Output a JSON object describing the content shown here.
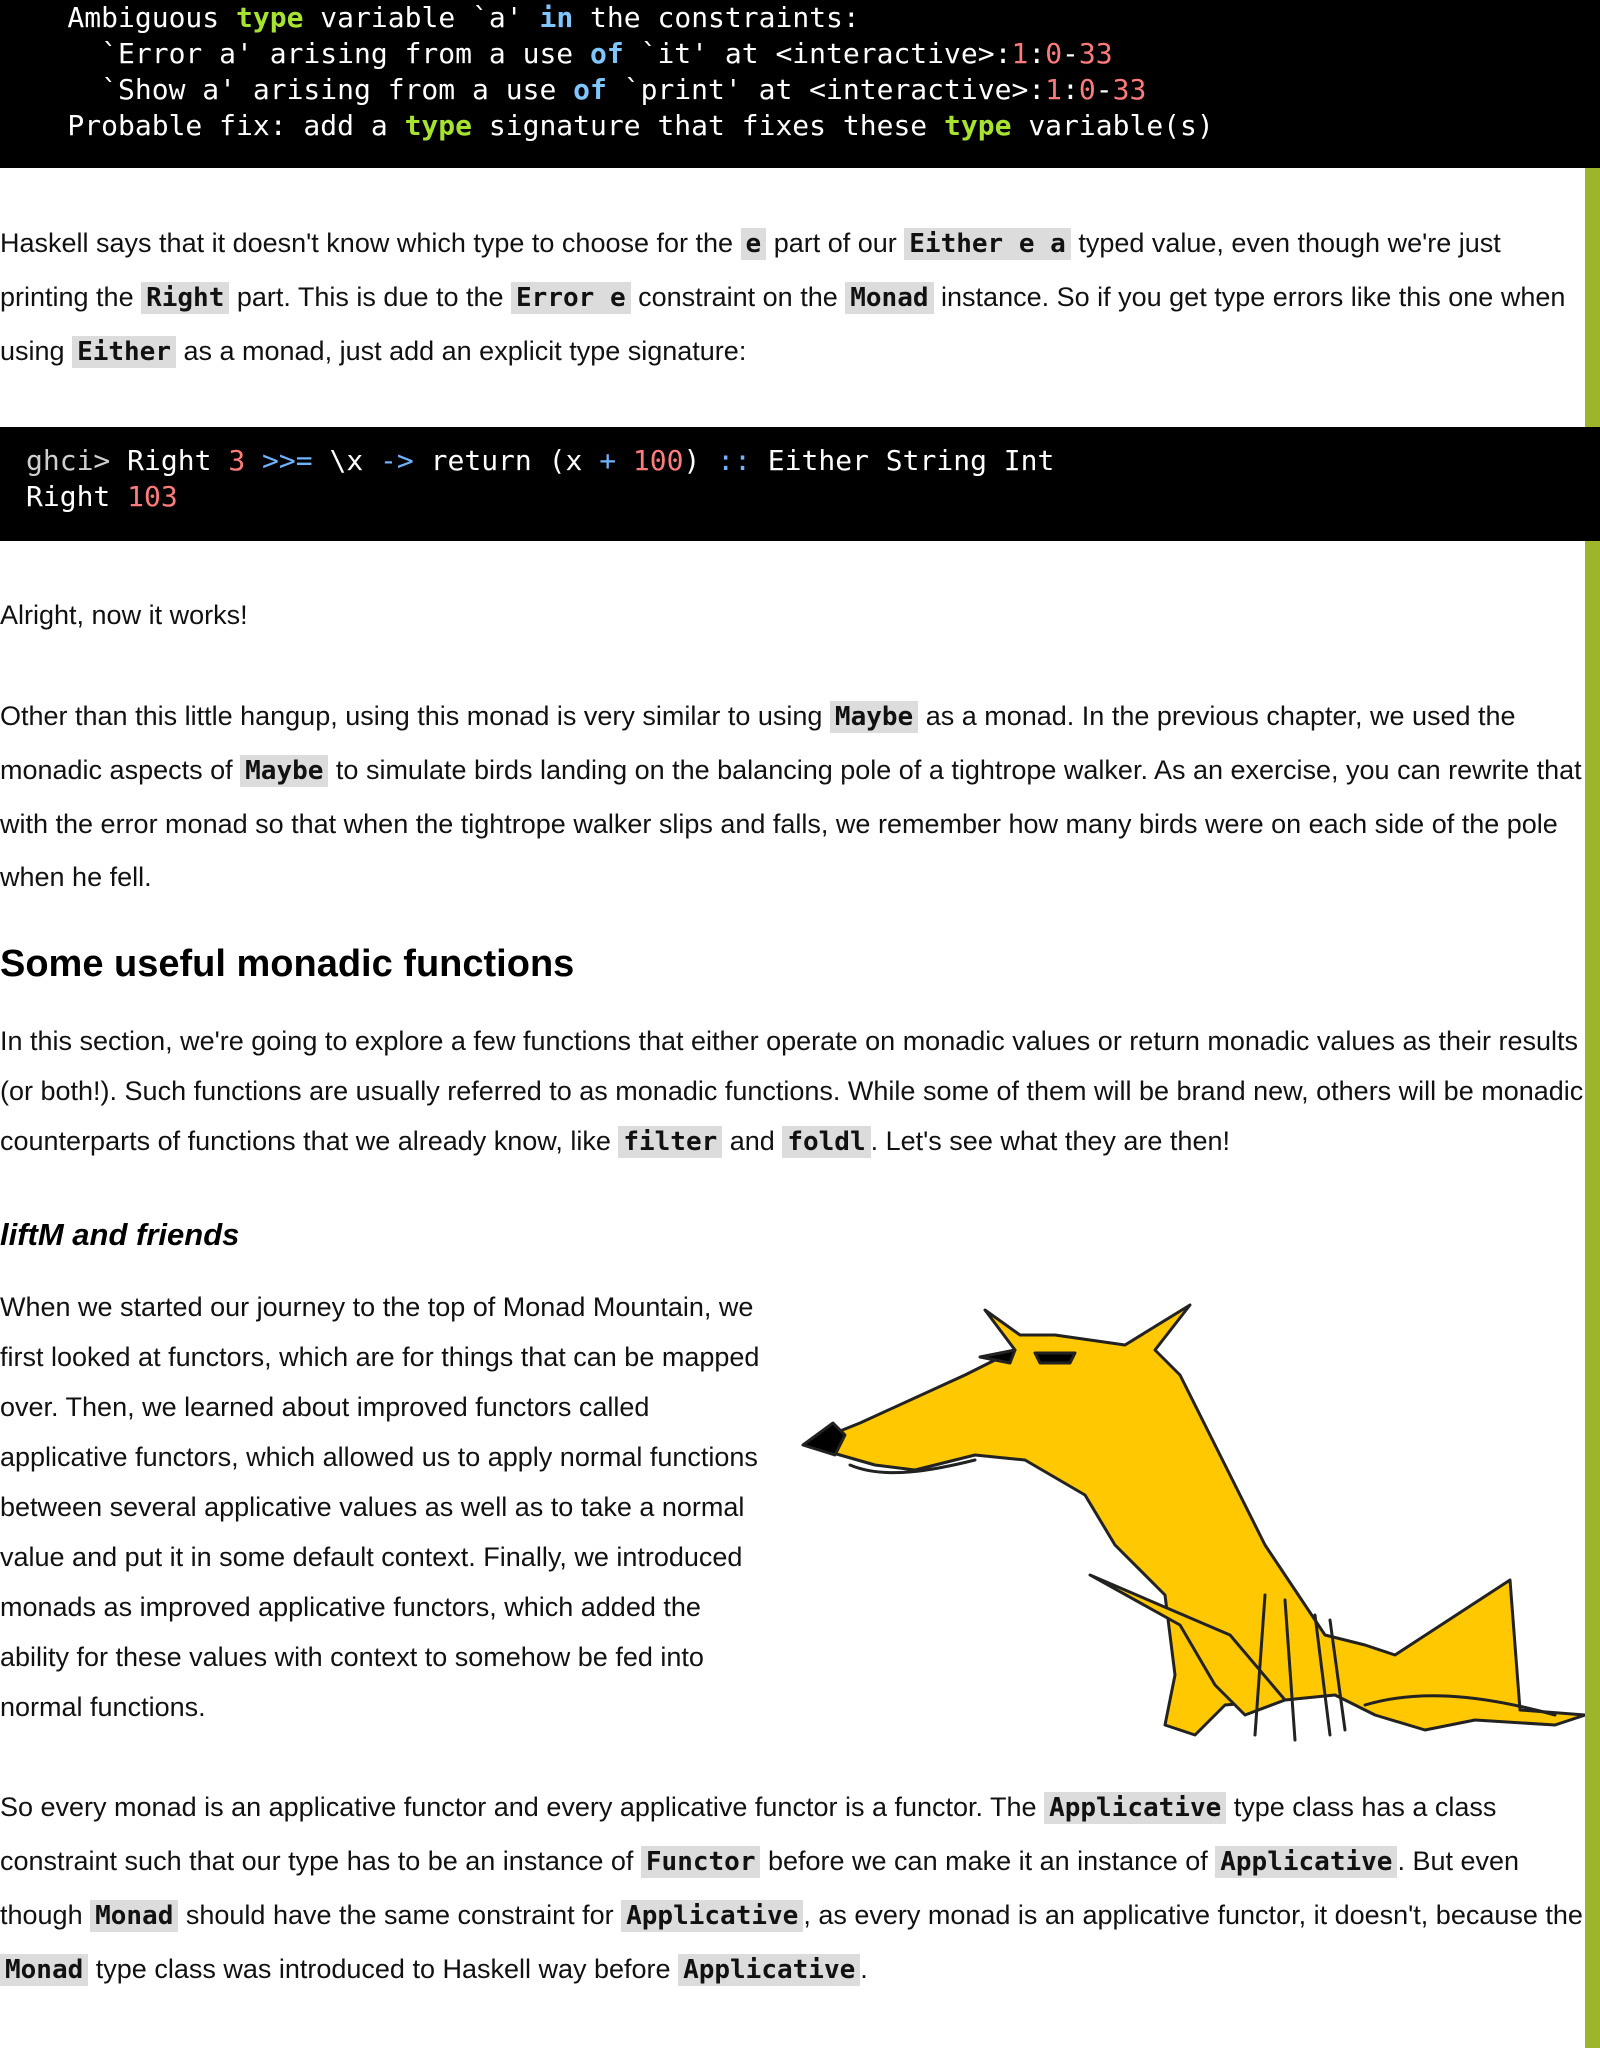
{
  "code_block_1": {
    "line1_a": "    Ambiguous ",
    "line1_type": "type",
    "line1_b": " variable `a' ",
    "line1_in": "in",
    "line1_c": " the constraints:",
    "line2_a": "      `Error a' arising from a use ",
    "line2_of": "of",
    "line2_b": " `it' at <interactive>:",
    "line2_n1": "1",
    "line2_c": ":",
    "line2_n2": "0",
    "line2_d": "-",
    "line2_n3": "33",
    "line3_a": "      `Show a' arising from a use ",
    "line3_of": "of",
    "line3_b": " `print' at <interactive>:",
    "line3_n1": "1",
    "line3_c": ":",
    "line3_n2": "0",
    "line3_d": "-",
    "line3_n3": "33",
    "line4_a": "    Probable fix: add a ",
    "line4_type1": "type",
    "line4_b": " signature that fixes these ",
    "line4_type2": "type",
    "line4_c": " variable(s)"
  },
  "para1": {
    "t1": "Haskell says that it doesn't know which type to choose for the ",
    "c1": "e",
    "t2": " part of our ",
    "c2": "Either e a",
    "t3": " typed value, even though we're just printing the ",
    "c3": "Right",
    "t4": " part. This is due to the ",
    "c4": "Error e",
    "t5": " constraint on the ",
    "c5": "Monad",
    "t6": " instance. So if you get type errors like this one when using ",
    "c6": "Either",
    "t7": " as a monad, just add an explicit type signature:"
  },
  "code_block_2": {
    "prompt": "ghci>",
    "a": " Right ",
    "n1": "3",
    "sp1": " ",
    "bind": ">>=",
    "b": " \\x ",
    "arrow": "->",
    "c": " return (x ",
    "plus": "+",
    "sp2": " ",
    "n2": "100",
    "d": ") ",
    "dcolon": "::",
    "e": " Either String Int",
    "line2_a": "Right ",
    "line2_n": "103"
  },
  "para2": "Alright, now it works!",
  "para3": {
    "t1": "Other than this little hangup, using this monad is very similar to using ",
    "c1": "Maybe",
    "t2": " as a monad. In the previous chapter, we used the monadic aspects of ",
    "c2": "Maybe",
    "t3": " to simulate birds landing on the balancing pole of a tightrope walker. As an exercise, you can rewrite that with the error monad so that when the tightrope walker slips and falls, we remember how many birds were on each side of the pole when he fell."
  },
  "heading_section": "Some useful monadic functions",
  "para4": {
    "t1": "In this section, we're going to explore a few functions that either operate on monadic values or return monadic values as their results (or both!). Such functions are usually referred to as monadic functions. While some of them will be brand new, others will be monadic counterparts of functions that we already know, like ",
    "c1": "filter",
    "t2": " and ",
    "c2": "foldl",
    "t3": ". Let's see what they are then!"
  },
  "heading_sub": "liftM and friends",
  "para5": "When we started our journey to the top of Monad Mountain, we first looked at functors, which are for things that can be mapped over. Then, we learned about improved functors called applicative functors, which allowed us to apply normal functions between several applicative values as well as to take a normal value and put it in some default context. Finally, we introduced monads as improved applicative functors, which added the ability for these values with context to somehow be fed into normal functions.",
  "para6": {
    "t1": "So every monad is an applicative functor and every applicative functor is a functor. The ",
    "c1": "Applicative",
    "t2": " type class has a class constraint such that our type has to be an instance of ",
    "c2": "Functor",
    "t3": " before we can make it an instance of ",
    "c3": "Applicative",
    "t4": ". But even though ",
    "c4": "Monad",
    "t5": " should have the same constraint for ",
    "c5": "Applicative",
    "t6": ", as every monad is an applicative functor, it doesn't, because the ",
    "c6": "Monad",
    "t7": " type class was introduced to Haskell way before ",
    "c7": "Applicative",
    "t8": "."
  },
  "colors": {
    "accent_bar": "#9db52a",
    "code_bg": "#000000",
    "keyword_green": "#a6e22e",
    "keyword_blue": "#7fc6ff",
    "number": "#ff7a7a",
    "wolf_fill": "#ffc800"
  }
}
